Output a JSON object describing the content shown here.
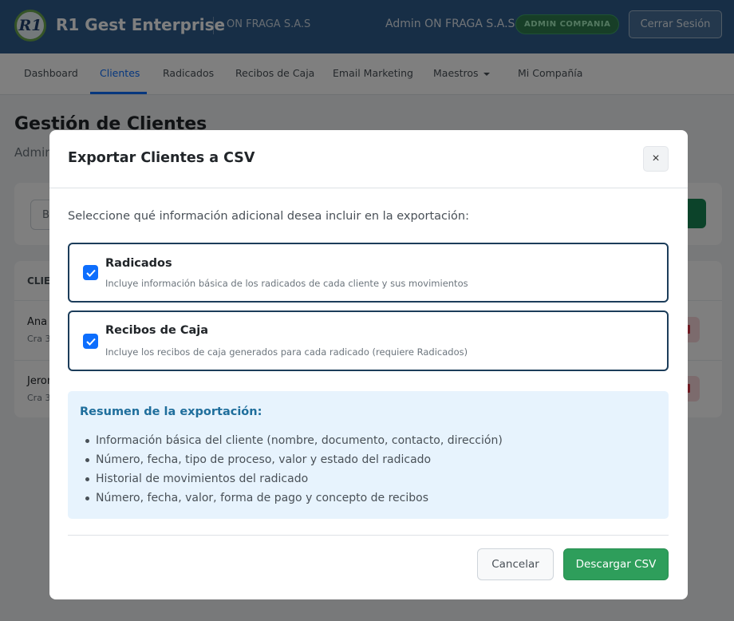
{
  "header": {
    "logo_text": "R1",
    "app_title": "R1 Gest Enterprise",
    "company": "ON FRAGA S.A.S",
    "user_name": "Admin ON FRAGA S.A.S",
    "role_badge": "ADMIN COMPANIA",
    "logout_label": "Cerrar Sesión"
  },
  "nav": {
    "items": [
      {
        "label": "Dashboard"
      },
      {
        "label": "Clientes",
        "active": true
      },
      {
        "label": "Radicados"
      },
      {
        "label": "Recibos de Caja"
      },
      {
        "label": "Email Marketing"
      },
      {
        "label": "Maestros"
      },
      {
        "label": "Mi Compañía"
      }
    ]
  },
  "background": {
    "page_title": "Gestión de Clientes",
    "page_subtitle": "Admin",
    "search_placeholder": "B",
    "table_header": "CLIE",
    "rows": [
      {
        "name": "Ana",
        "sub": "Cra 3"
      },
      {
        "name": "Jeron",
        "sub": "Cra 3"
      }
    ]
  },
  "modal": {
    "title": "Exportar Clientes a CSV",
    "close_glyph": "×",
    "intro": "Seleccione qué información adicional desea incluir en la exportación:",
    "options": [
      {
        "title": "Radicados",
        "description": "Incluye información básica de los radicados de cada cliente y sus movimientos",
        "checked": true
      },
      {
        "title": "Recibos de Caja",
        "description": "Incluye los recibos de caja generados para cada radicado (requiere Radicados)",
        "checked": true
      }
    ],
    "summary": {
      "title": "Resumen de la exportación:",
      "items": [
        "Información básica del cliente (nombre, documento, contacto, dirección)",
        "Número, fecha, tipo de proceso, valor y estado del radicado",
        "Historial de movimientos del radicado",
        "Número, fecha, valor, forma de pago y concepto de recibos"
      ]
    },
    "cancel_label": "Cancelar",
    "download_label": "Descargar CSV"
  },
  "colors": {
    "header_bg": "#2f5d8c",
    "primary": "#0d6efd",
    "success": "#2e9e5b",
    "summary_bg": "#e7f3fd",
    "summary_title": "#1f6e9c"
  }
}
